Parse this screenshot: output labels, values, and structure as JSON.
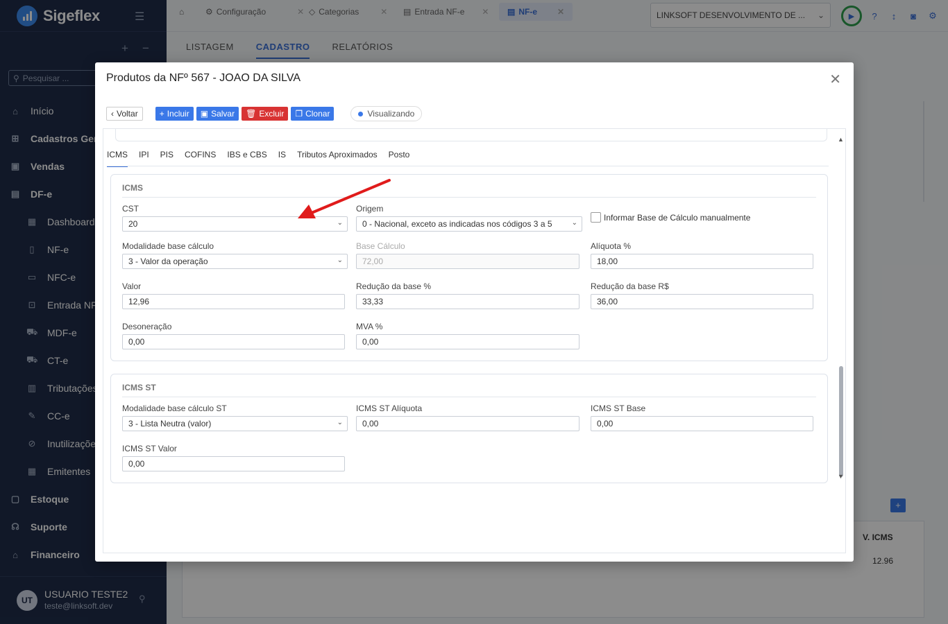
{
  "sidebar": {
    "logo": "Sigeflex",
    "search_placeholder": "Pesquisar ...",
    "items": [
      {
        "label": "Início",
        "icon": "home-icon",
        "bold": false,
        "sub": false
      },
      {
        "label": "Cadastros Gerais",
        "icon": "grid-icon",
        "bold": true,
        "sub": false
      },
      {
        "label": "Vendas",
        "icon": "bag-icon",
        "bold": true,
        "sub": false
      },
      {
        "label": "DF-e",
        "icon": "document-icon",
        "bold": true,
        "sub": false
      },
      {
        "label": "Dashboard",
        "icon": "dashboard-icon",
        "bold": false,
        "sub": true
      },
      {
        "label": "NF-e",
        "icon": "file-icon",
        "bold": false,
        "sub": true
      },
      {
        "label": "NFC-e",
        "icon": "receipt-icon",
        "bold": false,
        "sub": true
      },
      {
        "label": "Entrada NF-e",
        "icon": "file-in-icon",
        "bold": false,
        "sub": true
      },
      {
        "label": "MDF-e",
        "icon": "truck-icon",
        "bold": false,
        "sub": true
      },
      {
        "label": "CT-e",
        "icon": "truck-icon",
        "bold": false,
        "sub": true
      },
      {
        "label": "Tributações",
        "icon": "calculator-icon",
        "bold": false,
        "sub": true
      },
      {
        "label": "CC-e",
        "icon": "edit-icon",
        "bold": false,
        "sub": true
      },
      {
        "label": "Inutilizações",
        "icon": "block-icon",
        "bold": false,
        "sub": true
      },
      {
        "label": "Emitentes",
        "icon": "building-icon",
        "bold": false,
        "sub": true
      },
      {
        "label": "Estoque",
        "icon": "box-icon",
        "bold": true,
        "sub": false
      },
      {
        "label": "Suporte",
        "icon": "headset-icon",
        "bold": true,
        "sub": false
      },
      {
        "label": "Financeiro",
        "icon": "bank-icon",
        "bold": true,
        "sub": false
      }
    ],
    "user": {
      "initials": "UT",
      "name": "USUARIO TESTE2",
      "email": "teste@linksoft.dev"
    }
  },
  "topbar": {
    "tabs": [
      "Configuração",
      "Categorias",
      "Entrada NF-e",
      "NF-e"
    ],
    "company": "LINKSOFT DESENVOLVIMENTO DE ..."
  },
  "subtabs": [
    "LISTAGEM",
    "CADASTRO",
    "RELATÓRIOS"
  ],
  "background": {
    "col_header": "V. ICMS",
    "cell_value": "12.96"
  },
  "modal": {
    "title": "Produtos da NFº 567 - JOAO DA SILVA",
    "toolbar": {
      "back": "Voltar",
      "add": "Incluir",
      "save": "Salvar",
      "delete": "Excluir",
      "clone": "Clonar",
      "status": "Visualizando"
    },
    "tabs": [
      "ICMS",
      "IPI",
      "PIS",
      "COFINS",
      "IBS e CBS",
      "IS",
      "Tributos Aproximados",
      "Posto"
    ],
    "icms": {
      "title": "ICMS",
      "cst_label": "CST",
      "cst_value": "20",
      "origem_label": "Origem",
      "origem_value": "0 - Nacional, exceto as indicadas nos códigos 3 a 5",
      "manual_label": "Informar Base de Cálculo manualmente",
      "modalidade_label": "Modalidade base cálculo",
      "modalidade_value": "3 - Valor da operação",
      "base_label": "Base Cálculo",
      "base_value": "72,00",
      "aliquota_label": "Alíquota %",
      "aliquota_value": "18,00",
      "valor_label": "Valor",
      "valor_value": "12,96",
      "reducao_pct_label": "Redução da base %",
      "reducao_pct_value": "33,33",
      "reducao_rs_label": "Redução da base R$",
      "reducao_rs_value": "36,00",
      "desoneracao_label": "Desoneração",
      "desoneracao_value": "0,00",
      "mva_label": "MVA %",
      "mva_value": "0,00"
    },
    "icms_st": {
      "title": "ICMS ST",
      "modalidade_label": "Modalidade base cálculo ST",
      "modalidade_value": "3 - Lista Neutra (valor)",
      "aliquota_label": "ICMS ST Alíquota",
      "aliquota_value": "0,00",
      "base_label": "ICMS ST Base",
      "base_value": "0,00",
      "valor_label": "ICMS ST Valor",
      "valor_value": "0,00"
    }
  }
}
